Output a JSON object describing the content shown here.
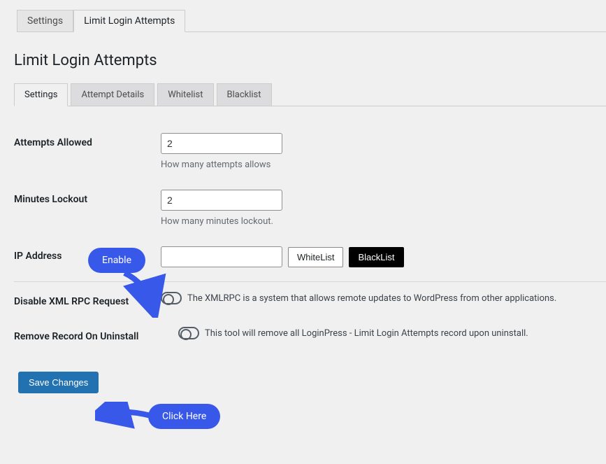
{
  "top_tabs": {
    "settings": "Settings",
    "limit": "Limit Login Attempts"
  },
  "page_title": "Limit Login Attempts",
  "sub_tabs": {
    "settings": "Settings",
    "details": "Attempt Details",
    "whitelist": "Whitelist",
    "blacklist": "Blacklist"
  },
  "fields": {
    "attempts_label": "Attempts Allowed",
    "attempts_value": "2",
    "attempts_desc": "How many attempts allows",
    "minutes_label": "Minutes Lockout",
    "minutes_value": "2",
    "minutes_desc": "How many minutes lockout.",
    "ip_label": "IP Address",
    "ip_value": "",
    "whitelist_btn": "WhiteList",
    "blacklist_btn": "BlackList",
    "xmlrpc_label": "Disable XML RPC Request",
    "xmlrpc_desc": "The XMLRPC is a system that allows remote updates to WordPress from other applications.",
    "remove_label": "Remove Record On Uninstall",
    "remove_desc": "This tool will remove all LoginPress - Limit Login Attempts record upon uninstall."
  },
  "save_btn": "Save Changes",
  "callouts": {
    "enable": "Enable",
    "click": "Click Here"
  }
}
